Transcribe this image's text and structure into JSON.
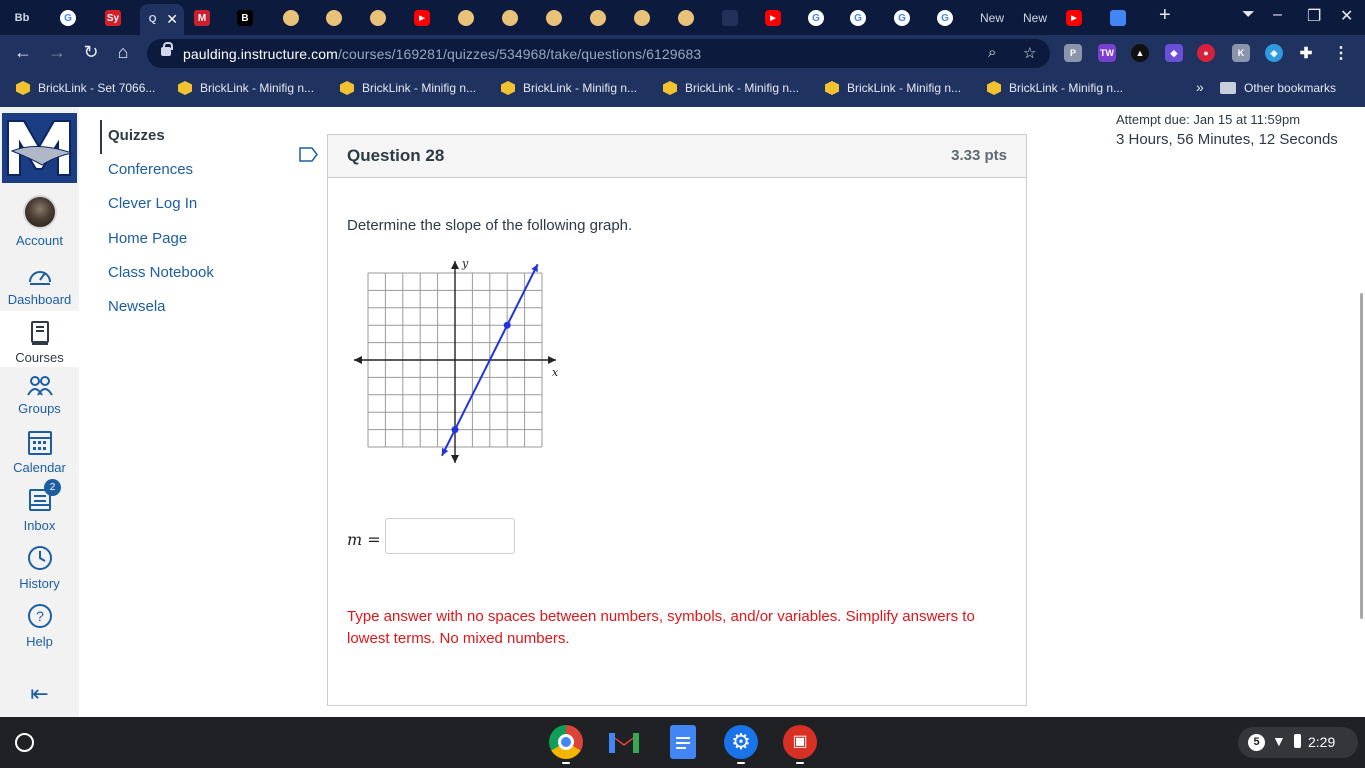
{
  "browser": {
    "tabs": [
      {
        "label": "Bb",
        "color": "#0c1b3d",
        "text": "Bb"
      },
      {
        "label": "G",
        "color": "#ffffff",
        "text": "G"
      },
      {
        "label": "Sy",
        "color": "#d5202a",
        "text": "Sy"
      },
      {
        "label": "Q",
        "color": "#1f3260",
        "text": "Q"
      },
      {
        "label": "M",
        "color": "#c8202f",
        "text": "M"
      },
      {
        "label": "B",
        "color": "#000000",
        "text": "B"
      }
    ],
    "new_tab_labels": [
      "New",
      "New"
    ],
    "url_host": "paulding.instructure.com",
    "url_path": "/courses/169281/quizzes/534968/take/questions/6129683"
  },
  "bookmarks": {
    "items": [
      "BrickLink - Set 7066...",
      "BrickLink - Minifig n...",
      "BrickLink - Minifig n...",
      "BrickLink - Minifig n...",
      "BrickLink - Minifig n...",
      "BrickLink - Minifig n...",
      "BrickLink - Minifig n..."
    ],
    "overflow": "»",
    "other": "Other bookmarks"
  },
  "global_nav": {
    "account": "Account",
    "dashboard": "Dashboard",
    "courses": "Courses",
    "groups": "Groups",
    "calendar": "Calendar",
    "inbox": "Inbox",
    "inbox_badge": "2",
    "history": "History",
    "help": "Help"
  },
  "course_nav": {
    "items": [
      "Quizzes",
      "Conferences",
      "Clever Log In",
      "Home Page",
      "Class Notebook",
      "Newsela"
    ]
  },
  "question": {
    "title": "Question 28",
    "points": "3.33 pts",
    "prompt": "Determine the slope of the following graph.",
    "answer_label": "m =",
    "answer_value": "",
    "note": "Type answer with no spaces between numbers, symbols, and/or variables. Simplify answers to lowest terms. No mixed numbers."
  },
  "graph": {
    "x_axis_label": "x",
    "y_axis_label": "y",
    "line_color": "#2233dd",
    "points": [
      [
        0,
        -4
      ],
      [
        3,
        2
      ]
    ],
    "grid_x_range": [
      -5,
      5
    ],
    "grid_y_range": [
      -5,
      5
    ]
  },
  "quiz_status": {
    "attempt_due": "Attempt due: Jan 15 at 11:59pm",
    "time_remaining": "3 Hours, 56 Minutes, 12 Seconds"
  },
  "shelf": {
    "notification_count": "5",
    "time": "2:29"
  },
  "colors": {
    "canvas_link": "#1c5ea1",
    "alert_red": "#e0161a",
    "browser_frame": "#1f3260"
  }
}
